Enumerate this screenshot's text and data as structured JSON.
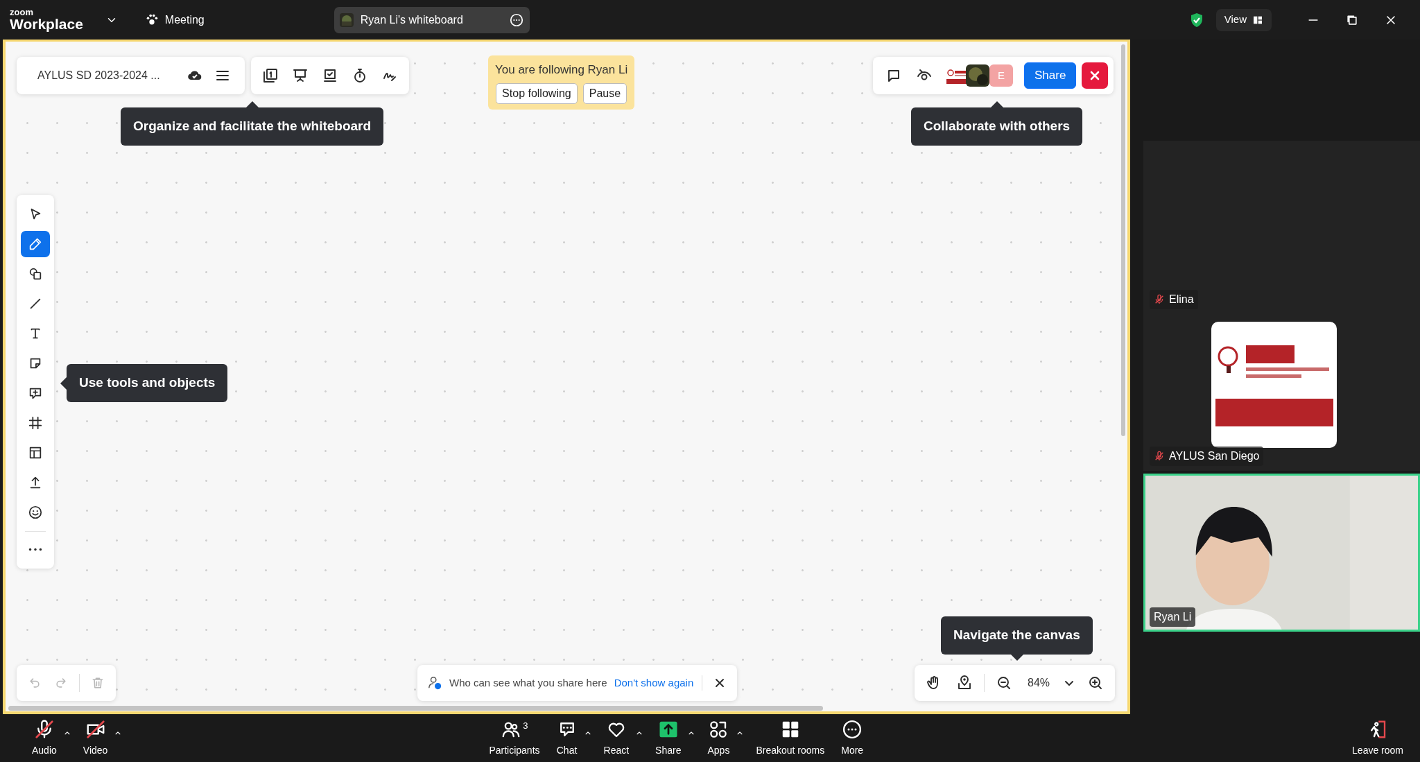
{
  "title_bar": {
    "logo_top": "zoom",
    "logo_bottom": "Workplace",
    "meeting_label": "Meeting",
    "tab_title": "Ryan Li's whiteboard",
    "view_label": "View"
  },
  "whiteboard": {
    "board_name": "AYLUS SD 2023-2024 ...",
    "follow_banner": {
      "text": "You are following Ryan Li",
      "buttons": [
        "Stop following",
        "Pause"
      ]
    },
    "collaborators": [
      {
        "kind": "picture"
      },
      {
        "kind": "picture"
      },
      {
        "kind": "initial",
        "text": "E"
      }
    ],
    "share_button": "Share",
    "tooltips": [
      {
        "text": "Organize and facilitate the whiteboard",
        "kind": "top"
      },
      {
        "text": "Collaborate with others",
        "kind": "top"
      },
      {
        "text": "Use tools and objects",
        "kind": "left"
      },
      {
        "text": "Navigate the canvas",
        "kind": "bottom"
      }
    ],
    "tools": [
      {
        "kind": "select",
        "selected": false
      },
      {
        "kind": "pen",
        "selected": true
      },
      {
        "kind": "shapes",
        "selected": false
      },
      {
        "kind": "line",
        "selected": false
      },
      {
        "kind": "text",
        "selected": false
      },
      {
        "kind": "note",
        "selected": false
      },
      {
        "kind": "comment",
        "selected": false
      },
      {
        "kind": "frame",
        "selected": false
      },
      {
        "kind": "template",
        "selected": false
      },
      {
        "kind": "upload",
        "selected": false
      },
      {
        "kind": "emoji",
        "selected": false
      },
      {
        "kind": "more",
        "selected": false
      }
    ],
    "history": [
      {
        "kind": "undo",
        "disabled": true
      },
      {
        "kind": "redo",
        "disabled": true
      },
      {
        "kind": "trash",
        "disabled": true
      }
    ],
    "notice": {
      "text": "Who can see what you share here",
      "link": "Don't show again"
    },
    "zoom_level": "84%"
  },
  "participants": [
    {
      "name": "Elina",
      "muted": true,
      "active": false
    },
    {
      "name": "AYLUS San Diego",
      "muted": true,
      "active": false,
      "kind": "avatar"
    },
    {
      "name": "Ryan Li",
      "muted": false,
      "active": true,
      "kind": "video"
    }
  ],
  "toolbar": [
    {
      "kind": "audio",
      "label": "Audio",
      "off": true,
      "menu": true
    },
    {
      "kind": "video",
      "label": "Video",
      "off": true,
      "menu": true
    },
    {
      "kind": "participants",
      "label": "Participants",
      "count": "3",
      "menu": false
    },
    {
      "kind": "chat",
      "label": "Chat",
      "menu": true
    },
    {
      "kind": "react",
      "label": "React",
      "menu": true
    },
    {
      "kind": "share",
      "label": "Share",
      "menu": true
    },
    {
      "kind": "apps",
      "label": "Apps",
      "menu": true
    },
    {
      "kind": "breakout",
      "label": "Breakout rooms",
      "menu": false
    },
    {
      "kind": "more",
      "label": "More",
      "menu": false
    },
    {
      "kind": "leave",
      "label": "Leave room",
      "menu": false
    }
  ]
}
